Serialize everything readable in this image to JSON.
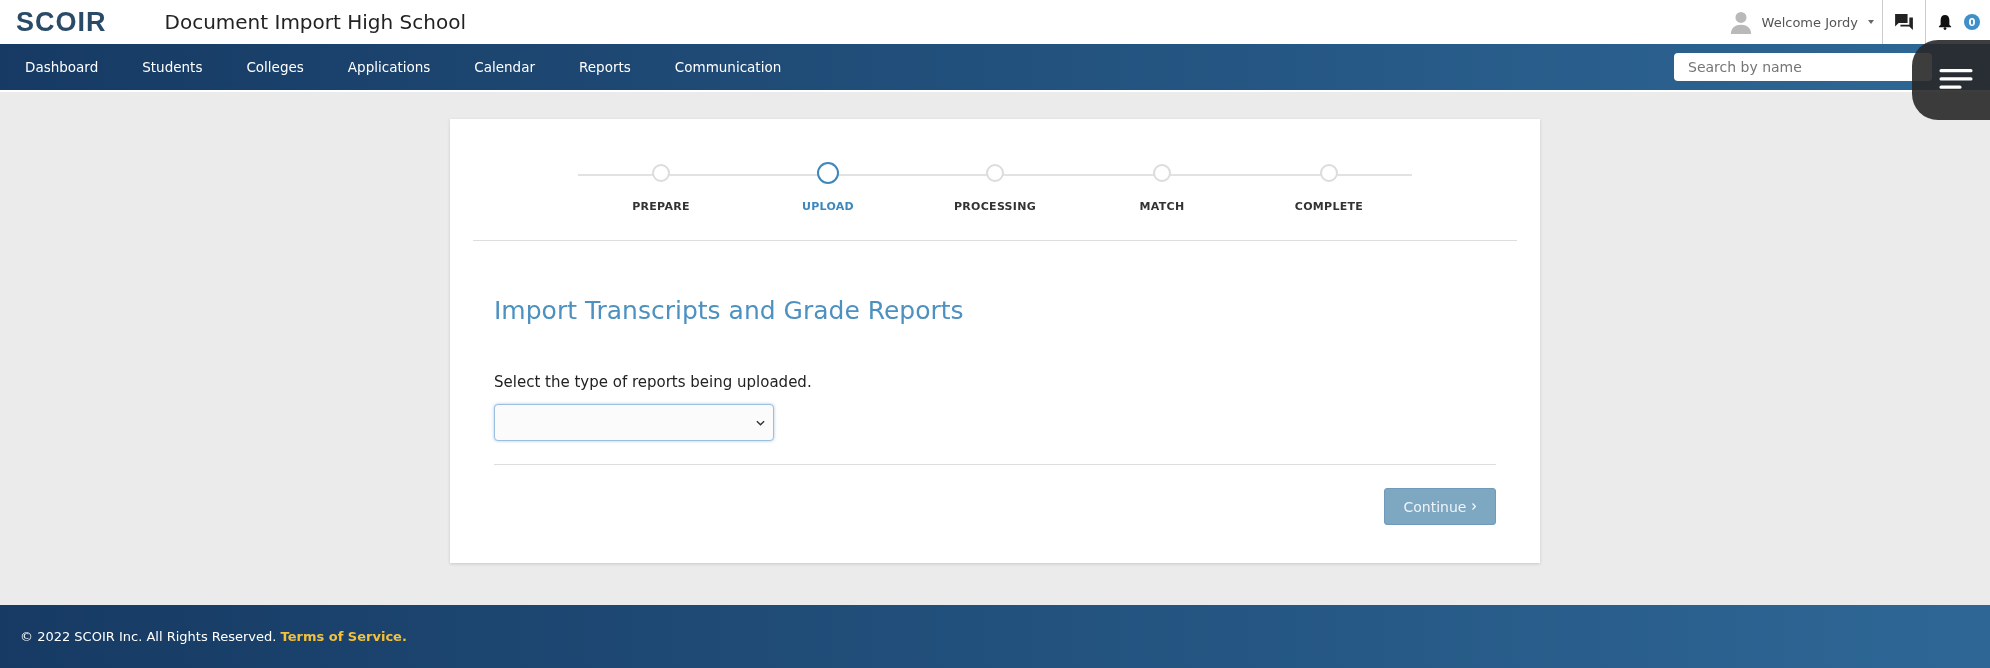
{
  "header": {
    "logo": "SCOIR",
    "school": "Document Import High School",
    "welcome": "Welcome Jordy",
    "notification_count": "0"
  },
  "nav": {
    "items": [
      "Dashboard",
      "Students",
      "Colleges",
      "Applications",
      "Calendar",
      "Reports",
      "Communication"
    ],
    "search": {
      "placeholder": "Search by name"
    }
  },
  "stepper": [
    {
      "label": "PREPARE",
      "selected": false
    },
    {
      "label": "UPLOAD",
      "selected": true
    },
    {
      "label": "PROCESSING",
      "selected": false
    },
    {
      "label": "MATCH",
      "selected": false
    },
    {
      "label": "COMPLETE",
      "selected": false
    }
  ],
  "form": {
    "title": "Import Transcripts and Grade Reports",
    "prompt": "Select the type of reports being uploaded.",
    "continue_button": {
      "label": "Continue",
      "disabled": true
    }
  },
  "footer": {
    "copyright": "© 2022 SCOIR Inc. All Rights Reserved.",
    "link": "Terms of Service."
  }
}
